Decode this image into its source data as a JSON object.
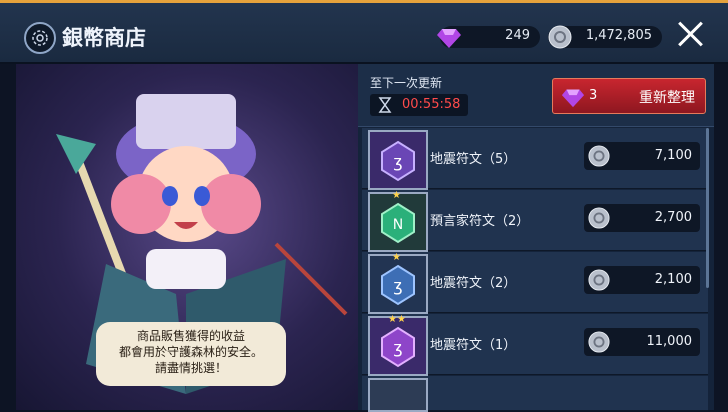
{
  "header": {
    "title": "銀幣商店",
    "gems": "249",
    "coins": "1,472,805"
  },
  "refresh": {
    "label": "至下一次更新",
    "time": "00:55:58",
    "cost": "3",
    "button": "重新整理"
  },
  "speech": {
    "lines": [
      "商品販售獲得的收益",
      "都會用於守護森林的安全。",
      "請盡情挑選！"
    ]
  },
  "items": [
    {
      "name": "地震符文（5）",
      "price": "7,100",
      "stars": "",
      "color": "#6a46b5"
    },
    {
      "name": "預言家符文（2）",
      "price": "2,700",
      "stars": "★",
      "color": "#2bb07a"
    },
    {
      "name": "地震符文（2）",
      "price": "2,100",
      "stars": "★",
      "color": "#3d6eb5"
    },
    {
      "name": "地震符文（1）",
      "price": "11,000",
      "stars": "★★",
      "color": "#8e45c9"
    }
  ]
}
